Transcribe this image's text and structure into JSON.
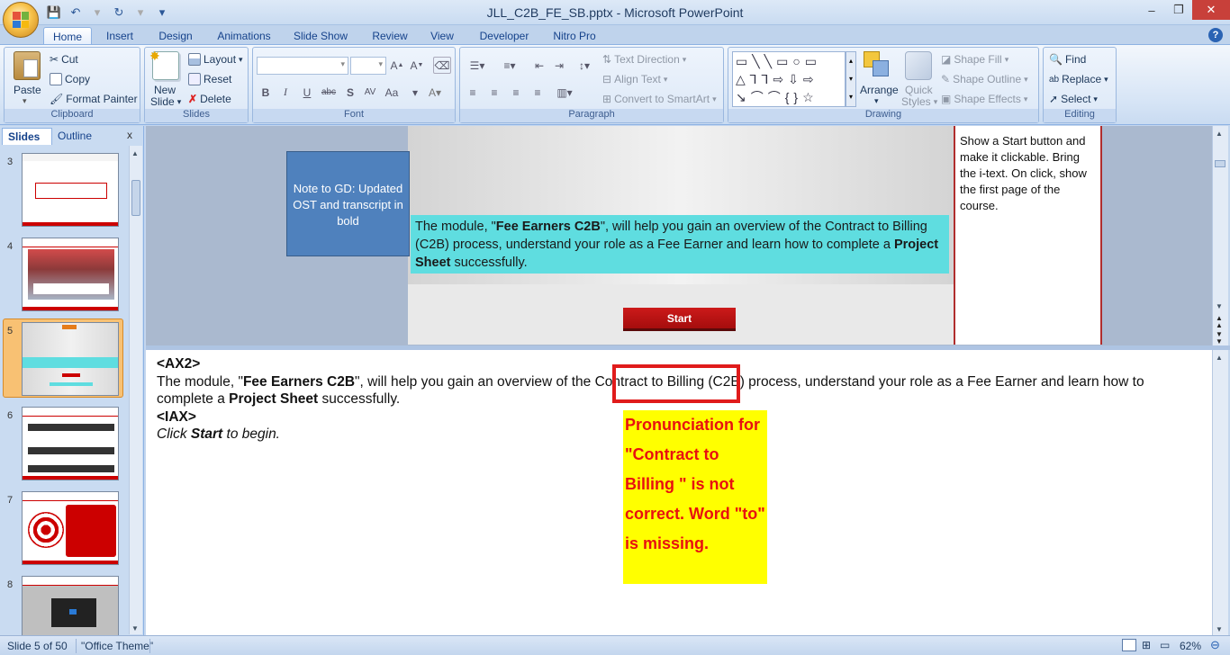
{
  "window": {
    "title": "JLL_C2B_FE_SB.pptx - Microsoft PowerPoint",
    "minimize": "–",
    "restore": "❐",
    "close": "✕"
  },
  "qat": {
    "save": "💾",
    "undo": "↶",
    "redo": "↻",
    "more": "▾"
  },
  "tabs": [
    {
      "label": "Home"
    },
    {
      "label": "Insert"
    },
    {
      "label": "Design"
    },
    {
      "label": "Animations"
    },
    {
      "label": "Slide Show"
    },
    {
      "label": "Review"
    },
    {
      "label": "View"
    },
    {
      "label": "Developer"
    },
    {
      "label": "Nitro Pro"
    }
  ],
  "help": "?",
  "ribbon": {
    "clipboard": {
      "label": "Clipboard",
      "paste": "Paste",
      "cut": "Cut",
      "copy": "Copy",
      "format_painter": "Format Painter"
    },
    "slides": {
      "label": "Slides",
      "new_slide_1": "New",
      "new_slide_2": "Slide",
      "layout": "Layout",
      "reset": "Reset",
      "delete": "Delete"
    },
    "font": {
      "label": "Font"
    },
    "paragraph": {
      "label": "Paragraph",
      "text_direction": "Text Direction",
      "align_text": "Align Text",
      "smartart": "Convert to SmartArt"
    },
    "drawing": {
      "label": "Drawing",
      "arrange": "Arrange",
      "quick_styles_1": "Quick",
      "quick_styles_2": "Styles",
      "shape_fill": "Shape Fill",
      "shape_outline": "Shape Outline",
      "shape_effects": "Shape Effects"
    },
    "editing": {
      "label": "Editing",
      "find": "Find",
      "replace": "Replace",
      "select": "Select"
    }
  },
  "left_pane": {
    "tab_slides": "Slides",
    "tab_outline": "Outline",
    "close": "x",
    "thumbs": [
      {
        "num": "3"
      },
      {
        "num": "4"
      },
      {
        "num": "5"
      },
      {
        "num": "6"
      },
      {
        "num": "7"
      },
      {
        "num": "8"
      }
    ]
  },
  "slide": {
    "note_gd": "Note to GD: Updated OST and transcript in bold",
    "module_pre": "The module, \"",
    "module_bold": "Fee Earners C2B",
    "module_mid": "\", will help you gain an overview of the Contract to Billing (C2B) process, understand your role as a Fee Earner and learn how to complete a ",
    "module_bold2": "Project Sheet",
    "module_post": " successfully.",
    "start": "Start",
    "right_note": "Show a Start button and make it clickable.  Bring the i-text. On click, show the first page of the course."
  },
  "notes": {
    "ax2": "<AX2>",
    "line_pre": "The module, \"",
    "line_bold": "Fee Earners C2B",
    "line_mid": "\", will help you gain an overview of the Contract to Billing (C2B) process, understand your role as a Fee Earner and learn how to complete a ",
    "line_bold2": "Project Sheet",
    "line_post": " successfully.",
    "iax": "<IAX>",
    "click_pre": "Click ",
    "click_bold": "Start",
    "click_post": " to begin.",
    "callout": "Pronunciation for \"Contract to Billing \" is not correct. Word \"to\" is missing."
  },
  "status": {
    "slide_info": "Slide 5 of 50",
    "theme": "\"Office Theme\"",
    "zoom": "62%"
  },
  "colors": {
    "accent": "#2b5797",
    "callout_bg": "#ffff00",
    "callout_text": "#e81010",
    "highlight_box": "#e01b1b",
    "cyan_box": "#5fdde0",
    "start_btn": "#c00000"
  }
}
